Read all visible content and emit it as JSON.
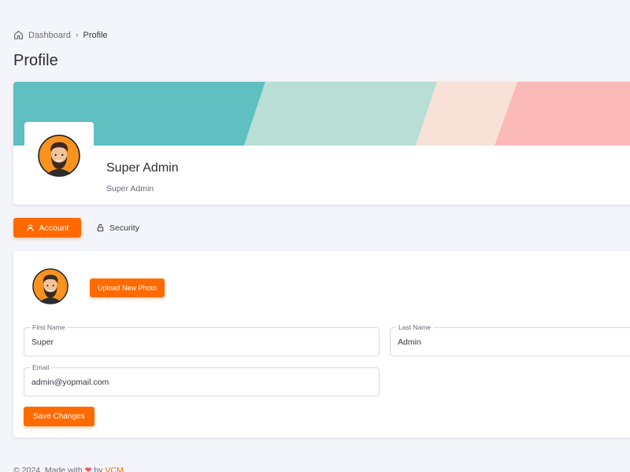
{
  "breadcrumb": {
    "home_icon": "home-icon",
    "items": [
      "Dashboard",
      "Profile"
    ],
    "separator": "›"
  },
  "page_title": "Profile",
  "profile": {
    "name": "Super Admin",
    "role": "Super Admin",
    "avatar_icon": "bearded-man-avatar"
  },
  "tabs": [
    {
      "label": "Account",
      "icon": "user-icon",
      "active": true
    },
    {
      "label": "Security",
      "icon": "lock-icon",
      "active": false
    }
  ],
  "account_form": {
    "upload_label": "Upload New Photo",
    "first_name": {
      "label": "First Name",
      "value": "Super"
    },
    "last_name": {
      "label": "Last Name",
      "value": "Admin"
    },
    "email": {
      "label": "Email",
      "value": "admin@yopmail.com"
    },
    "save_label": "Save Changes"
  },
  "footer": {
    "prefix": "© 2024, Made with",
    "heart": "❤",
    "by": "by",
    "brand": "VCM"
  },
  "colors": {
    "accent": "#ff6a00",
    "banner_teal": "#5fbfc1",
    "banner_mint": "#b8ded6",
    "banner_cream": "#f8e2d8",
    "banner_pink": "#fbb9b8"
  }
}
